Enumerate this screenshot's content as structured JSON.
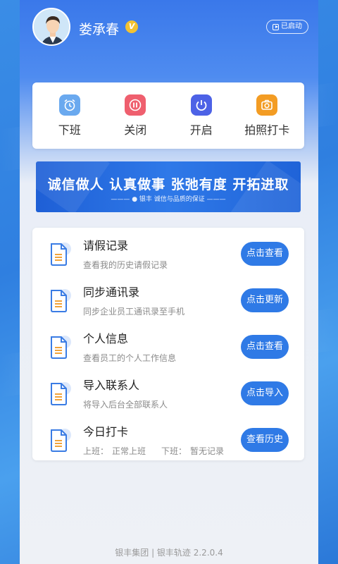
{
  "user": {
    "name": "娄承春",
    "vip_badge": "V",
    "status": "已启动"
  },
  "quick_actions": [
    {
      "label": "下班",
      "icon": "alarm-clock-icon",
      "color": "#6aa9ef"
    },
    {
      "label": "关闭",
      "icon": "pause-icon",
      "color": "#ef5f6e"
    },
    {
      "label": "开启",
      "icon": "power-icon",
      "color": "#4d62e6"
    },
    {
      "label": "拍照打卡",
      "icon": "camera-icon",
      "color": "#f39c23"
    }
  ],
  "banner": {
    "slogan": "诚信做人 认真做事 张弛有度 开拓进取",
    "subtitle": "——— ● 银丰  诚信与品质的保证 ———"
  },
  "list": [
    {
      "title": "请假记录",
      "desc": "查看我的历史请假记录",
      "button": "点击查看"
    },
    {
      "title": "同步通讯录",
      "desc": "同步企业员工通讯录至手机",
      "button": "点击更新"
    },
    {
      "title": "个人信息",
      "desc": "查看员工的个人工作信息",
      "button": "点击查看"
    },
    {
      "title": "导入联系人",
      "desc": "将导入后台全部联系人",
      "button": "点击导入"
    },
    {
      "title": "今日打卡",
      "button": "查看历史",
      "checkin": {
        "on_label": "上班：",
        "on_value": "正常上班",
        "off_label": "下班：",
        "off_value": "暂无记录"
      }
    }
  ],
  "footer": "银丰集团 | 银丰轨迹 2.2.0.4",
  "colors": {
    "accent": "#2f7ae6",
    "header_blue": "#3a78ea"
  }
}
